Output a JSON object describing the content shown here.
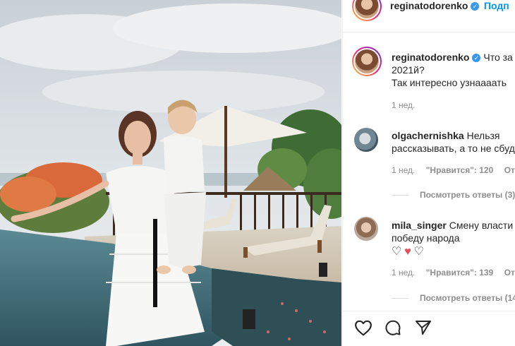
{
  "header": {
    "username": "reginatodorenko",
    "verified_icon": "verified-badge-icon",
    "follow_label": "Подп"
  },
  "caption": {
    "username": "reginatodorenko",
    "text_line1": "Что за",
    "text_line2": "2021й?",
    "text_line3": "Так интересно узнаааать",
    "time": "1 нед."
  },
  "comments": [
    {
      "username": "olgachernishka",
      "text_line1": "Нельзя",
      "text_line2": "рассказывать, а то не сбуд",
      "time": "1 нед.",
      "likes": "\"Нравится\": 120",
      "reply": "Отв",
      "view_replies": "Посмотреть ответы (3)"
    },
    {
      "username": "mila_singer",
      "text_line1": "Смену власти",
      "text_line2": "победу народа",
      "emoji": [
        "♡",
        "♥",
        "♡"
      ],
      "time": "1 нед.",
      "likes": "\"Нравится\": 139",
      "reply": "Отв",
      "view_replies": "Посмотреть ответы (14"
    }
  ],
  "actions": {
    "like_icon": "heart-icon",
    "comment_icon": "comment-icon",
    "share_icon": "share-icon"
  },
  "colors": {
    "accent": "#0095f6",
    "verified": "#3897f0",
    "heart_red": "#ed4956",
    "text": "#262626",
    "muted": "#8e8e8e"
  }
}
